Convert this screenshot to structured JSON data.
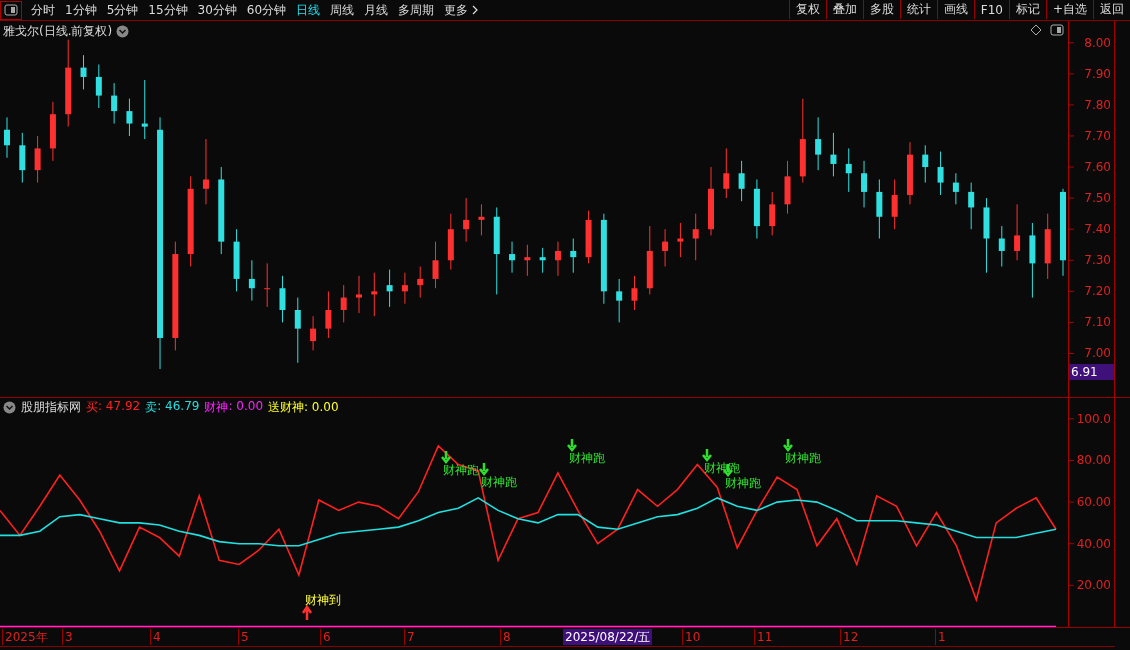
{
  "toolbar": {
    "periods": [
      {
        "label": "分时",
        "selected": false
      },
      {
        "label": "1分钟",
        "selected": false
      },
      {
        "label": "5分钟",
        "selected": false
      },
      {
        "label": "15分钟",
        "selected": false
      },
      {
        "label": "30分钟",
        "selected": false
      },
      {
        "label": "60分钟",
        "selected": false
      },
      {
        "label": "日线",
        "selected": true
      },
      {
        "label": "周线",
        "selected": false
      },
      {
        "label": "月线",
        "selected": false
      },
      {
        "label": "多周期",
        "selected": false
      }
    ],
    "more": "更多",
    "actions": [
      "复权",
      "叠加",
      "多股",
      "统计",
      "画线",
      "F10",
      "标记",
      "+自选",
      "返回"
    ]
  },
  "main_chart": {
    "title": "雅戈尔(日线.前复权)",
    "current_price": "6.91",
    "chart_data": {
      "type": "candlestick",
      "ylim": [
        6.86,
        8.07
      ],
      "yticks": [
        {
          "value": 8,
          "label": "8.00"
        },
        {
          "value": 7.9,
          "label": "7.90"
        },
        {
          "value": 7.8,
          "label": "7.80"
        },
        {
          "value": 7.7,
          "label": "7.70"
        },
        {
          "value": 7.6,
          "label": "7.60"
        },
        {
          "value": 7.5,
          "label": "7.50"
        },
        {
          "value": 7.4,
          "label": "7.40"
        },
        {
          "value": 7.3,
          "label": "7.30"
        },
        {
          "value": 7.2,
          "label": "7.20"
        },
        {
          "value": 7.1,
          "label": "7.10"
        },
        {
          "value": 7,
          "label": "7.00"
        }
      ],
      "categories": [
        null,
        null,
        null,
        null,
        null,
        null,
        null,
        null,
        null,
        null,
        null,
        null,
        null,
        null,
        null,
        null,
        null,
        null,
        null,
        null,
        null,
        null,
        null,
        null,
        null,
        null,
        null,
        null,
        null,
        null,
        null,
        null,
        null,
        null,
        null,
        null,
        null,
        null,
        null,
        null,
        null,
        null,
        null,
        null,
        null,
        null,
        null,
        null,
        null,
        null,
        null,
        null,
        null,
        null,
        null,
        null,
        null,
        null,
        null,
        null,
        null,
        null,
        null,
        null,
        null,
        null,
        null,
        null,
        null,
        null
      ],
      "ohlc": [
        [
          7.72,
          7.76,
          7.63,
          7.67
        ],
        [
          7.67,
          7.71,
          7.55,
          7.59
        ],
        [
          7.59,
          7.7,
          7.55,
          7.66
        ],
        [
          7.66,
          7.81,
          7.62,
          7.77
        ],
        [
          7.77,
          8.01,
          7.73,
          7.92
        ],
        [
          7.92,
          7.96,
          7.85,
          7.89
        ],
        [
          7.89,
          7.93,
          7.79,
          7.83
        ],
        [
          7.83,
          7.87,
          7.74,
          7.78
        ],
        [
          7.78,
          7.82,
          7.7,
          7.74
        ],
        [
          7.74,
          7.88,
          7.69,
          7.73
        ],
        [
          7.72,
          7.76,
          6.95,
          7.05
        ],
        [
          7.05,
          7.36,
          7.01,
          7.32
        ],
        [
          7.32,
          7.57,
          7.28,
          7.53
        ],
        [
          7.53,
          7.69,
          7.48,
          7.56
        ],
        [
          7.56,
          7.6,
          7.32,
          7.36
        ],
        [
          7.36,
          7.4,
          7.2,
          7.24
        ],
        [
          7.24,
          7.3,
          7.17,
          7.21
        ],
        [
          7.21,
          7.29,
          7.15,
          7.21
        ],
        [
          7.21,
          7.25,
          7.1,
          7.14
        ],
        [
          7.14,
          7.18,
          6.97,
          7.08
        ],
        [
          7.04,
          7.12,
          7.01,
          7.08
        ],
        [
          7.08,
          7.2,
          7.05,
          7.14
        ],
        [
          7.14,
          7.22,
          7.1,
          7.18
        ],
        [
          7.18,
          7.25,
          7.13,
          7.19
        ],
        [
          7.19,
          7.26,
          7.12,
          7.2
        ],
        [
          7.22,
          7.27,
          7.15,
          7.2
        ],
        [
          7.2,
          7.26,
          7.16,
          7.22
        ],
        [
          7.22,
          7.28,
          7.18,
          7.24
        ],
        [
          7.24,
          7.36,
          7.21,
          7.3
        ],
        [
          7.3,
          7.45,
          7.27,
          7.4
        ],
        [
          7.4,
          7.5,
          7.36,
          7.43
        ],
        [
          7.43,
          7.48,
          7.38,
          7.44
        ],
        [
          7.44,
          7.47,
          7.19,
          7.32
        ],
        [
          7.32,
          7.36,
          7.26,
          7.3
        ],
        [
          7.3,
          7.35,
          7.25,
          7.31
        ],
        [
          7.31,
          7.34,
          7.26,
          7.3
        ],
        [
          7.3,
          7.36,
          7.25,
          7.33
        ],
        [
          7.33,
          7.37,
          7.26,
          7.31
        ],
        [
          7.31,
          7.46,
          7.29,
          7.43
        ],
        [
          7.43,
          7.45,
          7.16,
          7.2
        ],
        [
          7.2,
          7.24,
          7.1,
          7.17
        ],
        [
          7.17,
          7.25,
          7.14,
          7.21
        ],
        [
          7.21,
          7.41,
          7.19,
          7.33
        ],
        [
          7.33,
          7.4,
          7.28,
          7.36
        ],
        [
          7.36,
          7.42,
          7.31,
          7.37
        ],
        [
          7.37,
          7.45,
          7.3,
          7.4
        ],
        [
          7.4,
          7.6,
          7.38,
          7.53
        ],
        [
          7.53,
          7.66,
          7.5,
          7.58
        ],
        [
          7.58,
          7.62,
          7.49,
          7.53
        ],
        [
          7.53,
          7.56,
          7.37,
          7.41
        ],
        [
          7.41,
          7.52,
          7.38,
          7.48
        ],
        [
          7.48,
          7.62,
          7.45,
          7.57
        ],
        [
          7.57,
          7.82,
          7.55,
          7.69
        ],
        [
          7.69,
          7.76,
          7.59,
          7.64
        ],
        [
          7.64,
          7.71,
          7.57,
          7.61
        ],
        [
          7.61,
          7.66,
          7.52,
          7.58
        ],
        [
          7.58,
          7.62,
          7.47,
          7.52
        ],
        [
          7.52,
          7.56,
          7.37,
          7.44
        ],
        [
          7.44,
          7.56,
          7.4,
          7.51
        ],
        [
          7.51,
          7.68,
          7.48,
          7.64
        ],
        [
          7.64,
          7.67,
          7.55,
          7.6
        ],
        [
          7.6,
          7.65,
          7.51,
          7.55
        ],
        [
          7.55,
          7.58,
          7.48,
          7.52
        ],
        [
          7.52,
          7.55,
          7.4,
          7.47
        ],
        [
          7.47,
          7.5,
          7.26,
          7.37
        ],
        [
          7.37,
          7.41,
          7.28,
          7.33
        ],
        [
          7.33,
          7.48,
          7.3,
          7.38
        ],
        [
          7.38,
          7.42,
          7.18,
          7.29
        ],
        [
          7.29,
          7.45,
          7.24,
          7.4
        ],
        [
          7.52,
          7.53,
          7.25,
          7.3
        ]
      ]
    }
  },
  "indicator": {
    "name": "股朋指标网",
    "legend_values": [
      ": 47.92",
      ": 46.79",
      ": 0.00"
    ],
    "extra_legend": {
      "label": "送财神: 0.00",
      "color": "#ffff20"
    },
    "signals": [
      {
        "kind": "sell",
        "text": "财神跑"
      },
      {
        "kind": "sell",
        "text": "财神跑"
      },
      {
        "kind": "sell",
        "text": "财神跑"
      },
      {
        "kind": "sell",
        "text": "财神跑"
      },
      {
        "kind": "sell",
        "text": "财神跑"
      },
      {
        "kind": "sell",
        "text": "财神跑"
      },
      {
        "kind": "buy",
        "text": "财神到"
      }
    ],
    "chart_data": {
      "type": "line",
      "ylim": [
        0,
        110
      ],
      "yticks": [
        {
          "value": 100,
          "label": "100.0"
        },
        {
          "value": 80,
          "label": "80.00"
        },
        {
          "value": 60,
          "label": "60.00"
        },
        {
          "value": 40,
          "label": "40.00"
        },
        {
          "value": 20,
          "label": "20.00"
        }
      ],
      "categories": [
        null,
        null,
        null,
        null,
        null,
        null,
        null,
        null,
        null,
        null,
        null,
        null,
        null,
        null,
        null,
        null,
        null,
        null,
        null,
        null,
        null,
        null,
        null,
        null,
        null,
        null,
        null,
        null,
        null,
        null,
        null,
        null,
        null,
        null,
        null,
        null,
        null,
        null,
        null,
        null,
        null,
        null,
        null,
        null,
        null,
        null,
        null,
        null,
        null,
        null,
        null,
        null,
        null,
        null
      ],
      "series": [
        {
          "name": "买",
          "color": "#ff2020",
          "values": [
            56,
            44,
            58,
            73,
            61,
            46,
            27,
            48,
            43,
            34,
            63,
            32,
            30,
            37,
            47,
            25,
            61,
            56,
            60,
            58,
            52,
            65,
            87,
            78,
            75,
            32,
            52,
            55,
            74,
            56,
            40,
            47,
            66,
            58,
            66,
            78,
            67,
            38,
            56,
            72,
            66,
            39,
            52,
            30,
            63,
            58,
            39,
            55,
            39,
            13,
            50,
            57,
            62,
            47
          ]
        },
        {
          "name": "卖",
          "color": "#20e0e0",
          "values": [
            44,
            44,
            46,
            53,
            54,
            52,
            50,
            50,
            49,
            46,
            44,
            41,
            40,
            40,
            39,
            39,
            42,
            45,
            46,
            47,
            48,
            51,
            55,
            57,
            62,
            56,
            52,
            50,
            54,
            54,
            48,
            47,
            50,
            53,
            54,
            57,
            62,
            58,
            56,
            60,
            61,
            60,
            56,
            51,
            51,
            51,
            50,
            49,
            46,
            43,
            43,
            43,
            45,
            47
          ]
        },
        {
          "name": "财神",
          "color": "#ff20ff",
          "values": [
            0,
            0,
            0,
            0,
            0,
            0,
            0,
            0,
            0,
            0,
            0,
            0,
            0,
            0,
            0,
            0,
            0,
            0,
            0,
            0,
            0,
            0,
            0,
            0,
            0,
            0,
            0,
            0,
            0,
            0,
            0,
            0,
            0,
            0,
            0,
            0,
            0,
            0,
            0,
            0,
            0,
            0,
            0,
            0,
            0,
            0,
            0,
            0,
            0,
            0,
            0,
            0,
            0,
            0
          ]
        }
      ]
    }
  },
  "time_axis": {
    "labels": [
      "2025年",
      "3",
      "4",
      "5",
      "6",
      "7",
      "8",
      "10",
      "11",
      "12",
      "1"
    ],
    "cursor_date": "2025/08/22/五"
  }
}
